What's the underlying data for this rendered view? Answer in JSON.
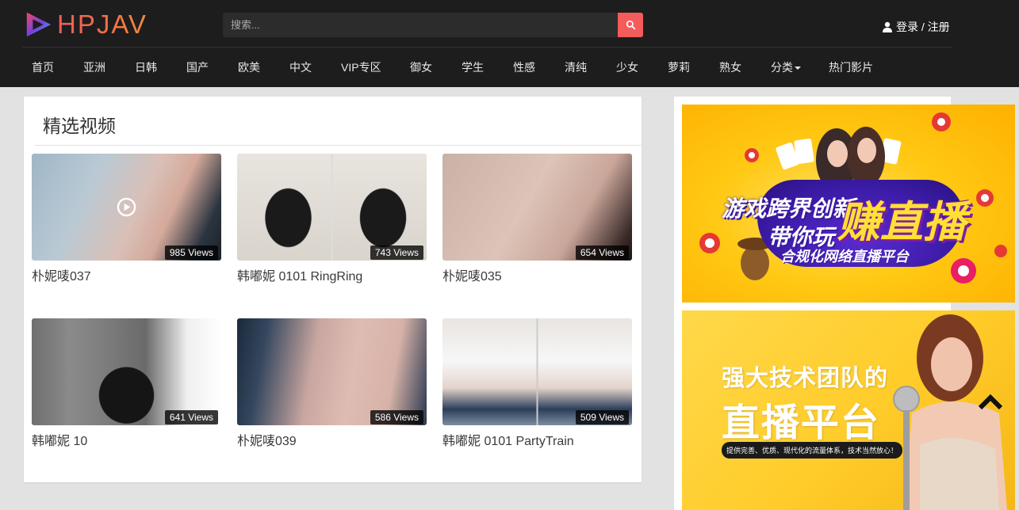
{
  "header": {
    "logo_text": "HPJAV",
    "search_placeholder": "搜索...",
    "login_label": "登录 / 注册",
    "colors": {
      "bar": "#1d1d1d",
      "accent": "#f45b5b"
    }
  },
  "nav": {
    "items": [
      "首页",
      "亚洲",
      "日韩",
      "国产",
      "欧美",
      "中文",
      "VIP专区",
      "御女",
      "学生",
      "性感",
      "清纯",
      "少女",
      "萝莉",
      "熟女",
      "分类",
      "热门影片"
    ]
  },
  "section": {
    "title": "精选视频"
  },
  "videos": [
    {
      "title": "朴妮唛037",
      "views": "985 Views"
    },
    {
      "title": "韩嘟妮 0101 RingRing",
      "views": "743 Views"
    },
    {
      "title": "朴妮唛035",
      "views": "654 Views"
    },
    {
      "title": "韩嘟妮 10",
      "views": "641 Views"
    },
    {
      "title": "朴妮唛039",
      "views": "586 Views"
    },
    {
      "title": "韩嘟妮 0101 PartyTrain",
      "views": "509 Views"
    }
  ],
  "ads": {
    "ad1": {
      "line1": "游戏跨界创新",
      "line2": "带你玩",
      "big": "赚直播",
      "sub": "合规化网络直播平台"
    },
    "ad2": {
      "line1": "强大技术团队的",
      "line2": "直播平台",
      "tag": "提供完善、优质、现代化的流量体系，技术当然放心！"
    }
  }
}
